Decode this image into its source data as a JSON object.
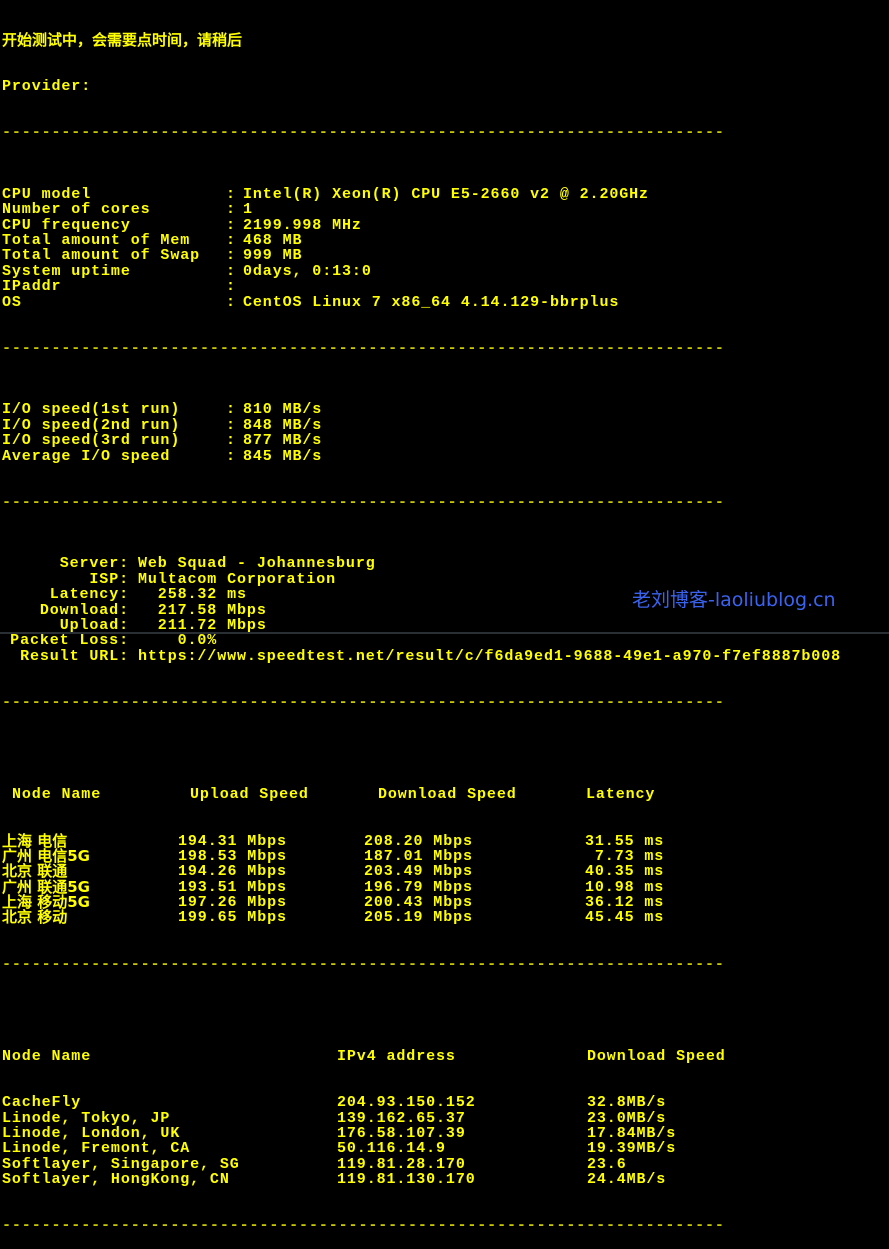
{
  "header": {
    "status_message": "开始测试中，会需要点时间，请稍后",
    "provider_label": "Provider:",
    "provider_value": ""
  },
  "divider": "-------------------------------------------------------------------------",
  "system_info": [
    {
      "label": "CPU model",
      "value": "Intel(R) Xeon(R) CPU E5-2660 v2 @ 2.20GHz"
    },
    {
      "label": "Number of cores",
      "value": "1"
    },
    {
      "label": "CPU frequency",
      "value": "2199.998 MHz"
    },
    {
      "label": "Total amount of Mem",
      "value": "468 MB"
    },
    {
      "label": "Total amount of Swap",
      "value": "999 MB"
    },
    {
      "label": "System uptime",
      "value": "0days, 0:13:0"
    },
    {
      "label": "IPaddr",
      "value": ""
    },
    {
      "label": "OS",
      "value": "CentOS Linux 7 x86_64 4.14.129-bbrplus"
    }
  ],
  "io_speed": [
    {
      "label": "I/O speed(1st run)",
      "value": "810 MB/s"
    },
    {
      "label": "I/O speed(2nd run)",
      "value": "848 MB/s"
    },
    {
      "label": "I/O speed(3rd run)",
      "value": "877 MB/s"
    },
    {
      "label": "Average I/O speed",
      "value": "845 MB/s"
    }
  ],
  "speedtest": [
    {
      "label": "Server:",
      "value": "Web Squad - Johannesburg"
    },
    {
      "label": "ISP:",
      "value": "Multacom Corporation"
    },
    {
      "label": "Latency:",
      "value": "  258.32 ms"
    },
    {
      "label": "Download:",
      "value": "  217.58 Mbps"
    },
    {
      "label": "Upload:",
      "value": "  211.72 Mbps"
    },
    {
      "label": "Packet Loss:",
      "value": "    0.0%"
    },
    {
      "label": "Result URL:",
      "value": "https://www.speedtest.net/result/c/f6da9ed1-9688-49e1-a970-f7ef8887b008"
    }
  ],
  "china_nodes": {
    "headers": [
      "Node Name",
      "Upload Speed",
      "Download Speed",
      "Latency"
    ],
    "rows": [
      {
        "node": "上海 电信",
        "upload": "194.31 Mbps",
        "download": "208.20 Mbps",
        "latency": "31.55 ms"
      },
      {
        "node": "广州 电信5G",
        "upload": "198.53 Mbps",
        "download": "187.01 Mbps",
        "latency": " 7.73 ms"
      },
      {
        "node": "北京 联通",
        "upload": "194.26 Mbps",
        "download": "203.49 Mbps",
        "latency": "40.35 ms"
      },
      {
        "node": "广州 联通5G",
        "upload": "193.51 Mbps",
        "download": "196.79 Mbps",
        "latency": "10.98 ms"
      },
      {
        "node": "上海 移动5G",
        "upload": "197.26 Mbps",
        "download": "200.43 Mbps",
        "latency": "36.12 ms"
      },
      {
        "node": "北京 移动",
        "upload": "199.65 Mbps",
        "download": "205.19 Mbps",
        "latency": "45.45 ms"
      }
    ]
  },
  "global_nodes": {
    "headers": [
      "Node Name",
      "IPv4 address",
      "Download Speed"
    ],
    "rows": [
      {
        "node": "CacheFly",
        "ip": "204.93.150.152",
        "speed": "32.8MB/s"
      },
      {
        "node": "Linode, Tokyo, JP",
        "ip": "139.162.65.37",
        "speed": "23.0MB/s"
      },
      {
        "node": "Linode, London, UK",
        "ip": "176.58.107.39",
        "speed": "17.84MB/s"
      },
      {
        "node": "Linode, Fremont, CA",
        "ip": "50.116.14.9",
        "speed": "19.39MB/s"
      },
      {
        "node": "Softlayer, Singapore, SG",
        "ip": "119.81.28.170",
        "speed": "23.6"
      },
      {
        "node": "Softlayer, HongKong, CN",
        "ip": "119.81.130.170",
        "speed": "24.4MB/s"
      }
    ]
  },
  "watermark": "老刘博客-laoliublog.cn",
  "colors": {
    "text": "#ffff00",
    "background": "#000000",
    "watermark": "#3a63f0"
  }
}
